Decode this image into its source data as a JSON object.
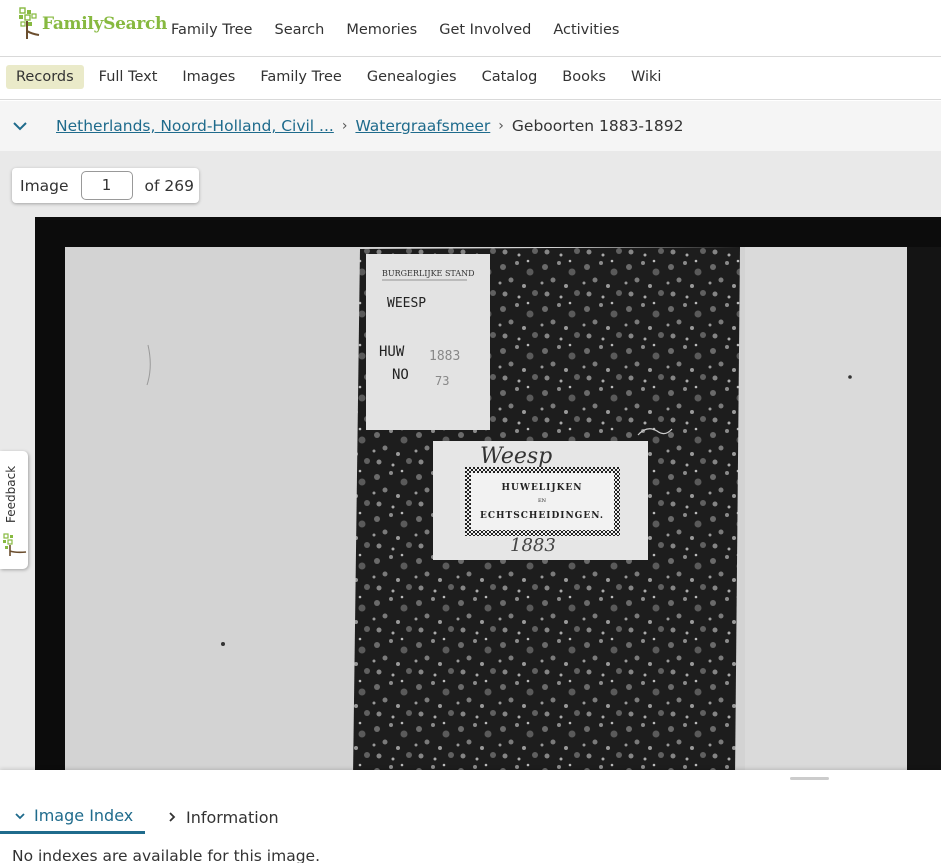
{
  "brand": {
    "name": "FamilySearch",
    "color": "#87b940"
  },
  "main_nav": [
    "Family Tree",
    "Search",
    "Memories",
    "Get Involved",
    "Activities"
  ],
  "sub_nav": {
    "items": [
      "Records",
      "Full Text",
      "Images",
      "Family Tree",
      "Genealogies",
      "Catalog",
      "Books",
      "Wiki"
    ],
    "active": "Records"
  },
  "breadcrumb": {
    "links": [
      "Netherlands, Noord-Holland, Civil ...",
      "Watergraafsmeer"
    ],
    "current": "Geboorten 1883-1892",
    "link_color": "#1f6b8c"
  },
  "image_nav": {
    "label": "Image",
    "current": "1",
    "total_text": "of 269"
  },
  "document": {
    "label_header": "BURGERLIJKE STAND",
    "label_place": "WEESP",
    "label_line1_left": "HUW",
    "label_line1_right": "1883",
    "label_line2_left": "NO",
    "label_line2_right": "73",
    "script_top": "Weesp",
    "title_line1": "HUWELIJKEN",
    "title_mid": "EN",
    "title_line2": "ECHTSCHEIDINGEN.",
    "script_year": "1883"
  },
  "feedback": {
    "label": "Feedback"
  },
  "bottom_panel": {
    "tabs": [
      "Image Index",
      "Information"
    ],
    "active_tab": "Image Index",
    "empty_message": "No indexes are available for this image."
  },
  "icons": {
    "logo": "familysearch-tree-logo",
    "breadcrumb_toggle": "chevron-down-icon",
    "tab_index": "chevron-down-icon",
    "tab_info": "chevron-right-icon"
  }
}
